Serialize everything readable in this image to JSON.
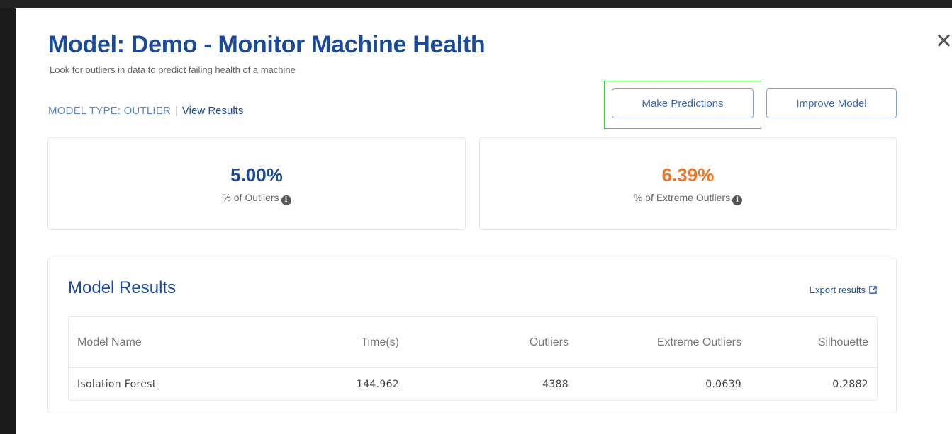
{
  "modal": {
    "title": "Model: Demo - Monitor Machine Health",
    "subtitle": "Look for outliers in data to predict failing health of a machine",
    "model_type": "MODEL TYPE: OUTLIER",
    "separator": "|",
    "view_results": "View Results",
    "close_icon": "close-icon"
  },
  "actions": {
    "make_predictions": "Make Predictions",
    "improve_model": "Improve Model"
  },
  "stats": {
    "outliers": {
      "value": "5.00%",
      "label": "% of Outliers",
      "icon": "info-icon"
    },
    "extreme_outliers": {
      "value": "6.39%",
      "label": "% of Extreme Outliers",
      "icon": "info-icon"
    }
  },
  "results": {
    "title": "Model Results",
    "export_label": "Export results",
    "export_icon": "external-link-icon",
    "columns": [
      "Model Name",
      "Time(s)",
      "Outliers",
      "Extreme Outliers",
      "Silhouette"
    ],
    "rows": [
      [
        "Isolation Forest",
        "144.962",
        "4388",
        "0.0639",
        "0.2882"
      ]
    ]
  },
  "colors": {
    "primary": "#1a4a9b",
    "accent_orange": "#f37521",
    "highlight": "#3fd13f"
  }
}
